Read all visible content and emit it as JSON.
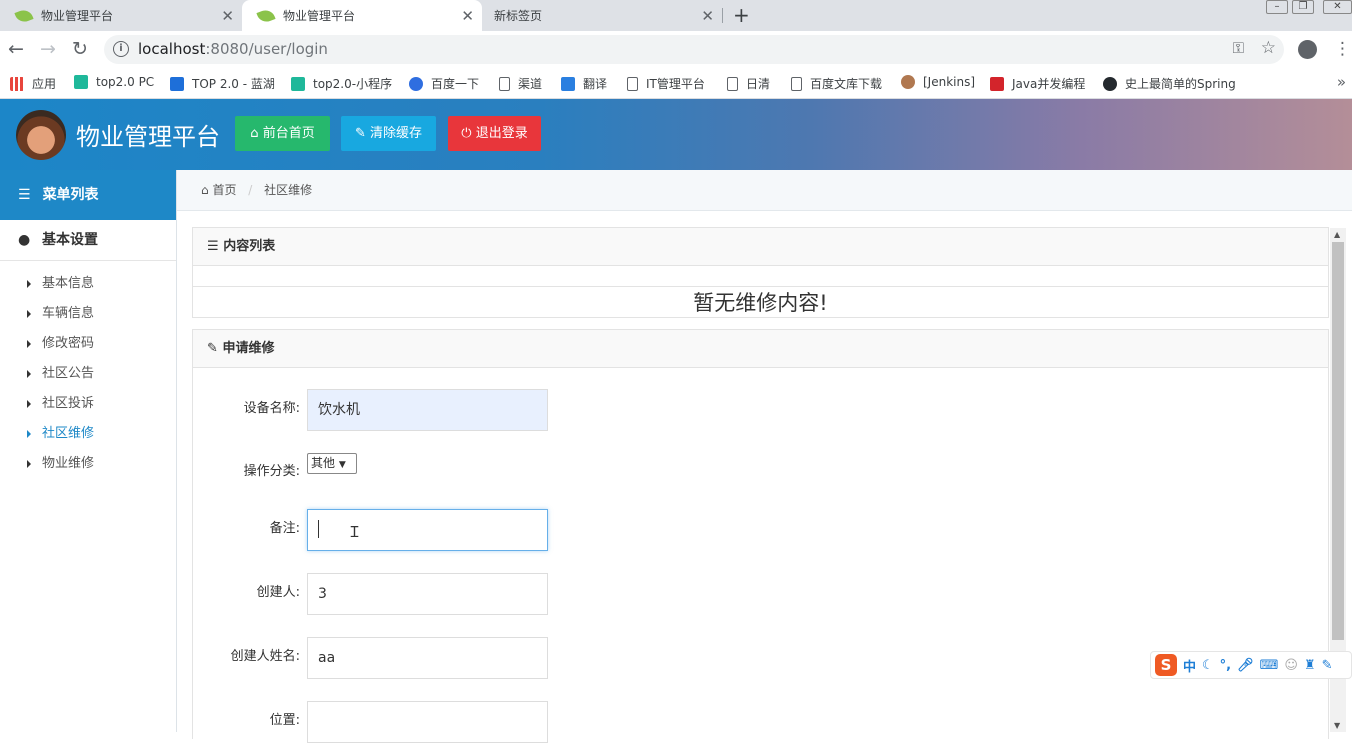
{
  "browser": {
    "tabs": [
      {
        "title": "物业管理平台",
        "active": false
      },
      {
        "title": "物业管理平台",
        "active": true
      },
      {
        "title": "新标签页",
        "active": false
      }
    ],
    "url_host": "localhost",
    "url_rest": ":8080/user/login",
    "bookmarks": [
      {
        "label": "应用",
        "color": "#e8453c"
      },
      {
        "label": "top2.0 PC",
        "color": "#1fb89a"
      },
      {
        "label": "TOP 2.0 - 蓝湖",
        "color": "#1e6fd9"
      },
      {
        "label": "top2.0-小程序",
        "color": "#1fb89a"
      },
      {
        "label": "百度一下",
        "color": "#2f6ee0"
      },
      {
        "label": "渠道",
        "color": "#5f6368"
      },
      {
        "label": "翻译",
        "color": "#2a7fe0"
      },
      {
        "label": "IT管理平台",
        "color": "#5f6368"
      },
      {
        "label": "日清",
        "color": "#5f6368"
      },
      {
        "label": "百度文库下载",
        "color": "#5f6368"
      },
      {
        "label": "[Jenkins]",
        "color": "#b07850"
      },
      {
        "label": "Java并发编程",
        "color": "#d3242b"
      },
      {
        "label": "史上最简单的Spring",
        "color": "#24292e"
      }
    ]
  },
  "header": {
    "title": "物业管理平台",
    "buttons": [
      {
        "label": "前台首页",
        "icon": "home-icon",
        "color": "#26b86d"
      },
      {
        "label": "清除缓存",
        "icon": "wrench-icon",
        "color": "#18a8e0"
      },
      {
        "label": "退出登录",
        "icon": "power-icon",
        "color": "#e8363b"
      }
    ]
  },
  "sidebar": {
    "heading": "菜单列表",
    "group": "基本设置",
    "items": [
      {
        "label": "基本信息",
        "active": false
      },
      {
        "label": "车辆信息",
        "active": false
      },
      {
        "label": "修改密码",
        "active": false
      },
      {
        "label": "社区公告",
        "active": false
      },
      {
        "label": "社区投诉",
        "active": false
      },
      {
        "label": "社区维修",
        "active": true
      },
      {
        "label": "物业维修",
        "active": false
      }
    ]
  },
  "breadcrumb": {
    "home": "首页",
    "current": "社区维修"
  },
  "list_panel": {
    "title": "内容列表",
    "empty_text": "暂无维修内容!"
  },
  "form_panel": {
    "title": "申请维修",
    "fields": {
      "device_name": {
        "label": "设备名称:",
        "value": "饮水机"
      },
      "category": {
        "label": "操作分类:",
        "value": "其他"
      },
      "remark": {
        "label": "备注:",
        "value": ""
      },
      "creator": {
        "label": "创建人:",
        "value": "3"
      },
      "creator_name": {
        "label": "创建人姓名:",
        "value": "aa"
      },
      "location": {
        "label": "位置:",
        "value": ""
      }
    }
  },
  "ime": {
    "mode": "中"
  }
}
